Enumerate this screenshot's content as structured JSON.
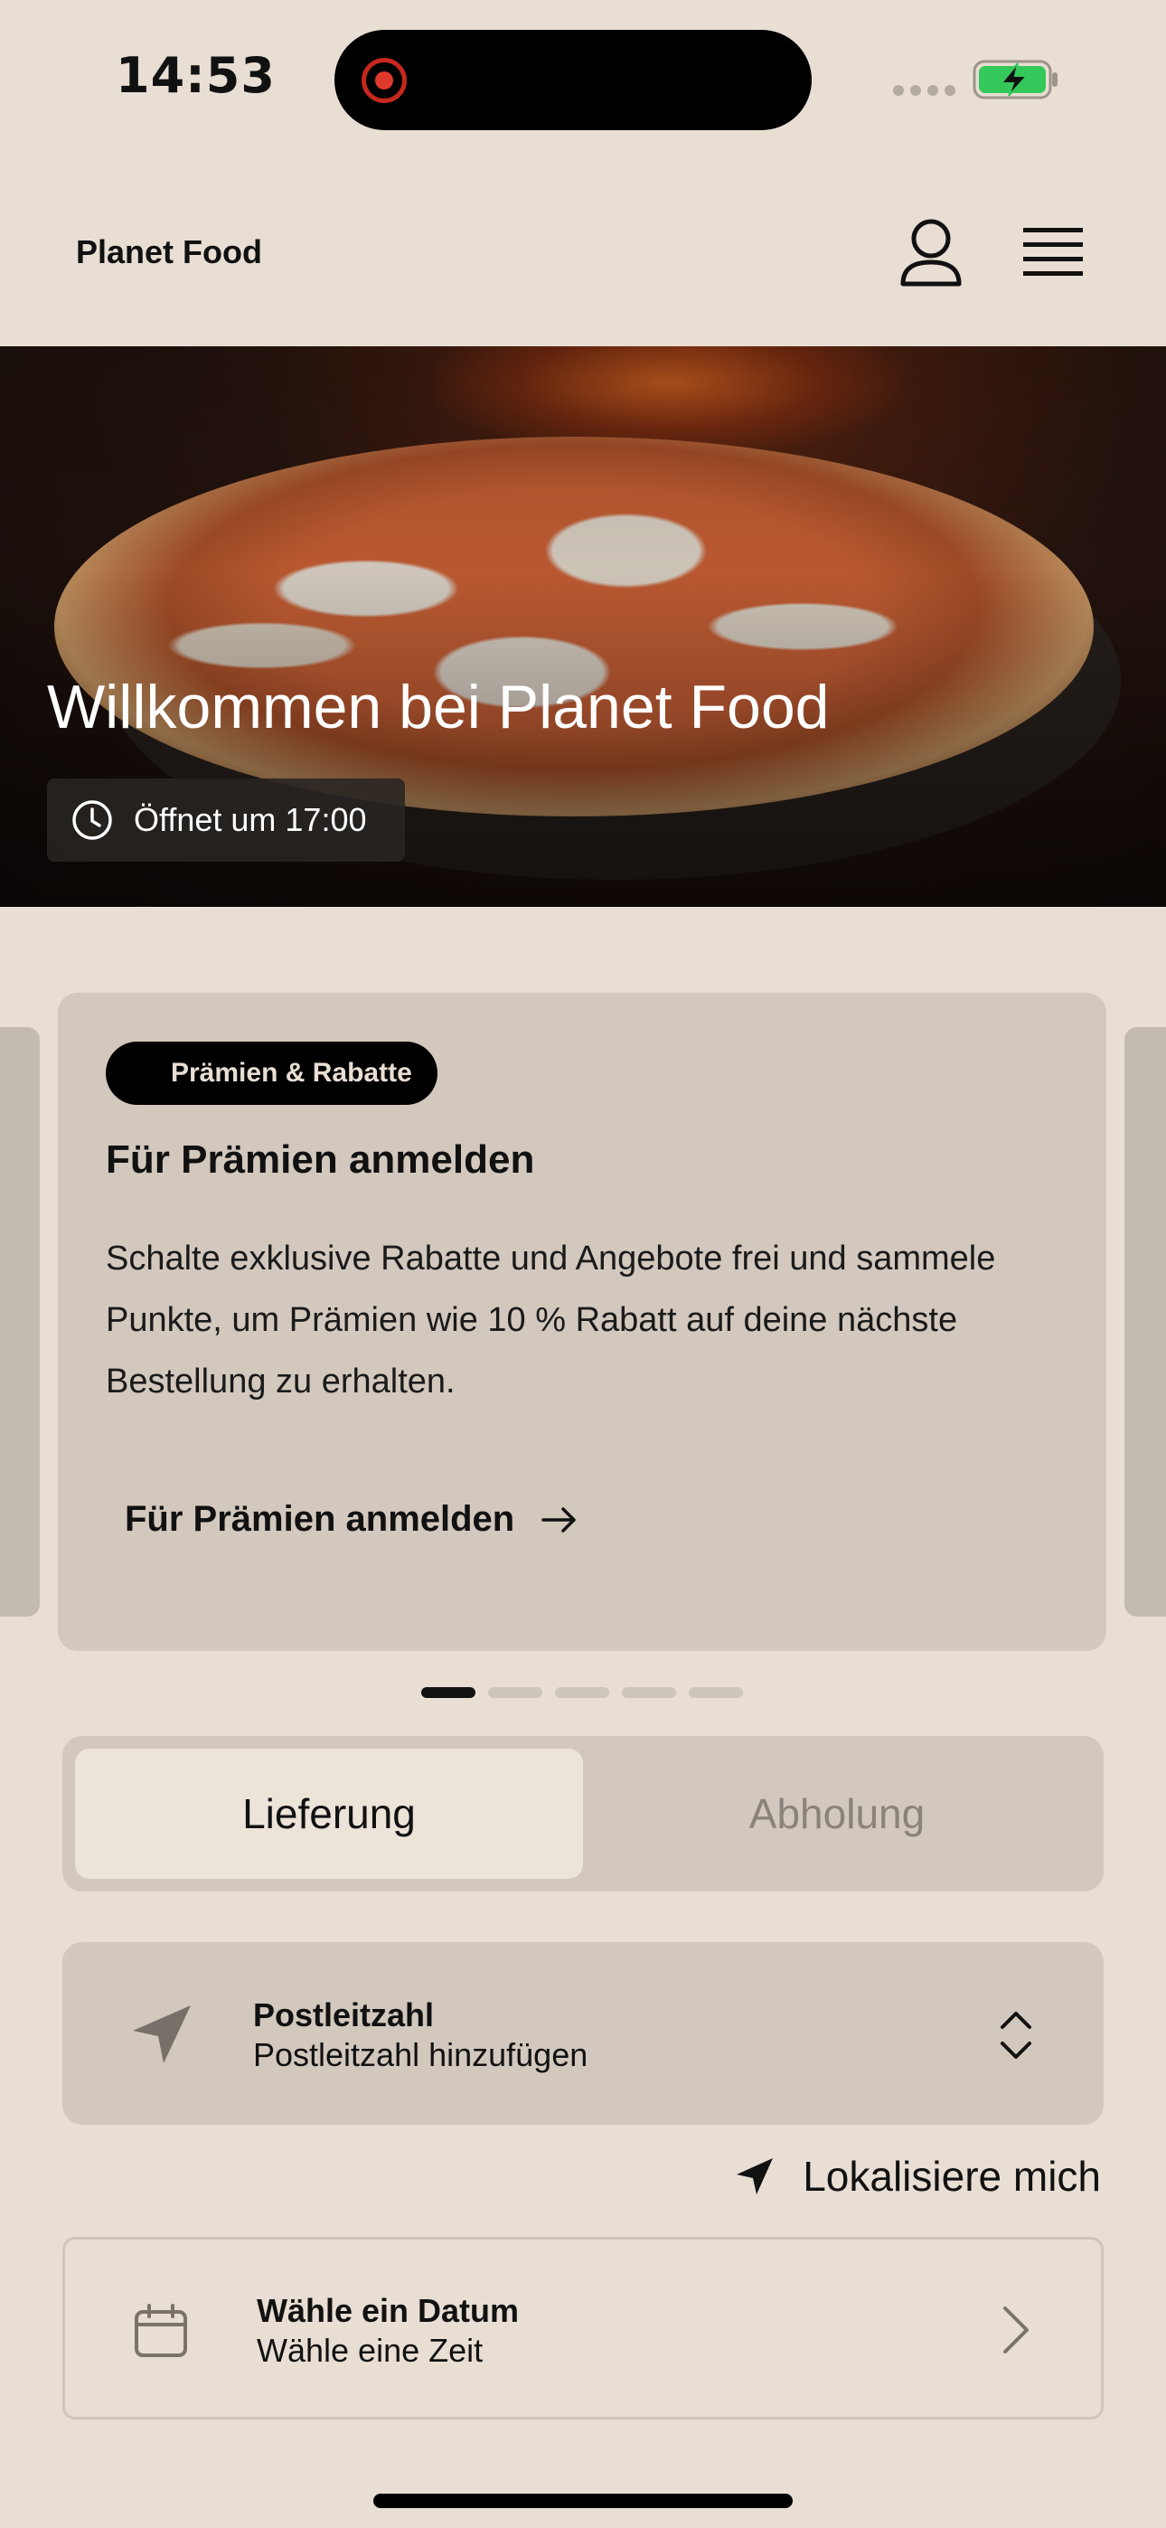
{
  "status_bar": {
    "time": "14:53"
  },
  "header": {
    "brand": "Planet Food"
  },
  "hero": {
    "title": "Willkommen bei Planet Food",
    "hours": "Öffnet um 17:00"
  },
  "promo_card": {
    "badge": "Prämien & Rabatte",
    "title": "Für Prämien anmelden",
    "body": "Schalte exklusive Rabatte und Angebote frei und sammele Punkte, um Prämien wie 10 % Rabatt auf deine nächste Bestellung zu erhalten.",
    "link": "Für Prämien anmelden"
  },
  "carousel": {
    "count": 5,
    "active_index": 0
  },
  "order_mode": {
    "options": [
      "Lieferung",
      "Abholung"
    ],
    "selected": "Lieferung"
  },
  "postal": {
    "title": "Postleitzahl",
    "placeholder": "Postleitzahl hinzufügen"
  },
  "locate": {
    "label": "Lokalisiere mich"
  },
  "schedule": {
    "title": "Wähle ein Datum",
    "subtitle": "Wähle eine Zeit"
  },
  "colors": {
    "background": "#e8ded3",
    "card": "#d2c8bd",
    "accent_dark": "#000000",
    "battery_green": "#34c759",
    "record_red": "#e0392c"
  }
}
